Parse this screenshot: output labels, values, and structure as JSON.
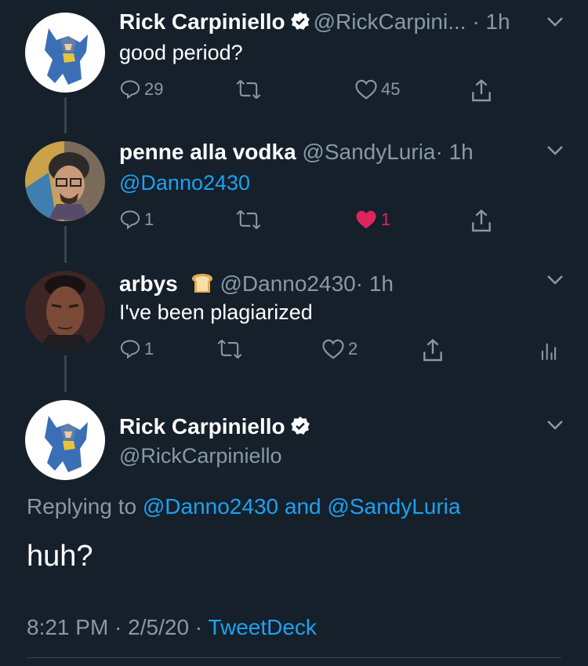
{
  "tweets": [
    {
      "name": "Rick Carpiniello",
      "handle": "@RickCarpini...",
      "time": "· 1h",
      "text": "good period?",
      "replies": "29",
      "retweets": "",
      "likes": "45"
    },
    {
      "name": "penne alla vodka",
      "handle": "@SandyLuria",
      "time": "· 1h",
      "text": "@Danno2430",
      "replies": "1",
      "retweets": "",
      "likes": "1"
    },
    {
      "name": "arbys",
      "handle": "@Danno2430",
      "time": "· 1h",
      "text": "I've been plagiarized",
      "replies": "1",
      "retweets": "",
      "likes": "2"
    }
  ],
  "main": {
    "name": "Rick Carpiniello",
    "handle": "@RickCarpiniello",
    "replying_prefix": "Replying to",
    "reply_user1": "@Danno2430",
    "reply_and": "and",
    "reply_user2": "@SandyLuria",
    "text": "huh?",
    "time": "8:21 PM",
    "date": "2/5/20",
    "client": "TweetDeck"
  },
  "colors": {
    "background": "#15202b",
    "link": "#1da1f2",
    "muted": "#8899a6",
    "like": "#e0245e"
  },
  "icons": [
    "verified-badge-icon",
    "chevron-down-icon",
    "reply-icon",
    "retweet-icon",
    "like-icon",
    "share-icon",
    "analytics-icon",
    "bread-emoji-icon"
  ]
}
